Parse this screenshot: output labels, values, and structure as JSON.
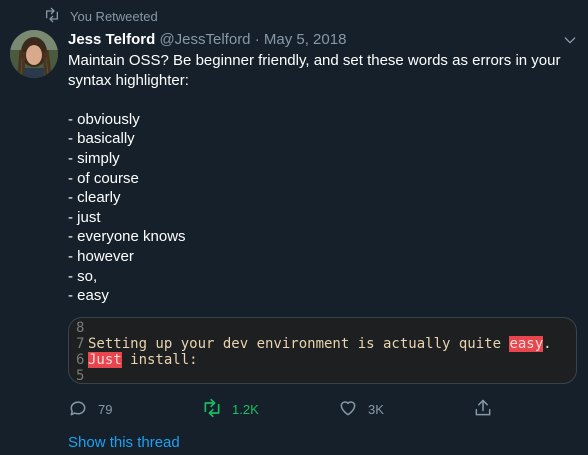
{
  "retweet_context": {
    "label": "You Retweeted",
    "icon": "retweet-icon"
  },
  "author": {
    "name": "Jess Telford",
    "handle": "@JessTelford",
    "separator": "·",
    "date": "May 5, 2018"
  },
  "tweet_lines": [
    "Maintain OSS? Be beginner friendly, and set these words as errors in your",
    "syntax highlighter:",
    "",
    "- obviously",
    "- basically",
    "- simply",
    "- of course",
    "- clearly",
    "- just",
    "- everyone knows",
    "- however",
    "- so,",
    "- easy"
  ],
  "code_image": {
    "lines": [
      {
        "num": "8",
        "before": "",
        "error": "",
        "after": ""
      },
      {
        "num": "7",
        "before": "Setting up your dev environment is actually quite ",
        "error": "easy",
        "after": "."
      },
      {
        "num": "6",
        "before": "",
        "error": "Just",
        "after": " install:"
      },
      {
        "num": "5",
        "before": "",
        "error": "",
        "after": ""
      }
    ],
    "colors": {
      "background": "#1d1f21",
      "text": "#e8d4b0",
      "error_highlight": "#e8454c",
      "line_number": "#7a7a7a"
    }
  },
  "actions": {
    "reply": {
      "count": "79",
      "icon": "reply-icon"
    },
    "retweet": {
      "count": "1.2K",
      "icon": "retweet-icon",
      "active_color": "#17bf63"
    },
    "like": {
      "count": "3K",
      "icon": "heart-icon"
    },
    "share": {
      "icon": "share-icon"
    }
  },
  "show_thread": "Show this thread",
  "colors": {
    "background": "#15202b",
    "muted": "#8899a6",
    "link": "#1da1f2",
    "text": "#ffffff"
  }
}
